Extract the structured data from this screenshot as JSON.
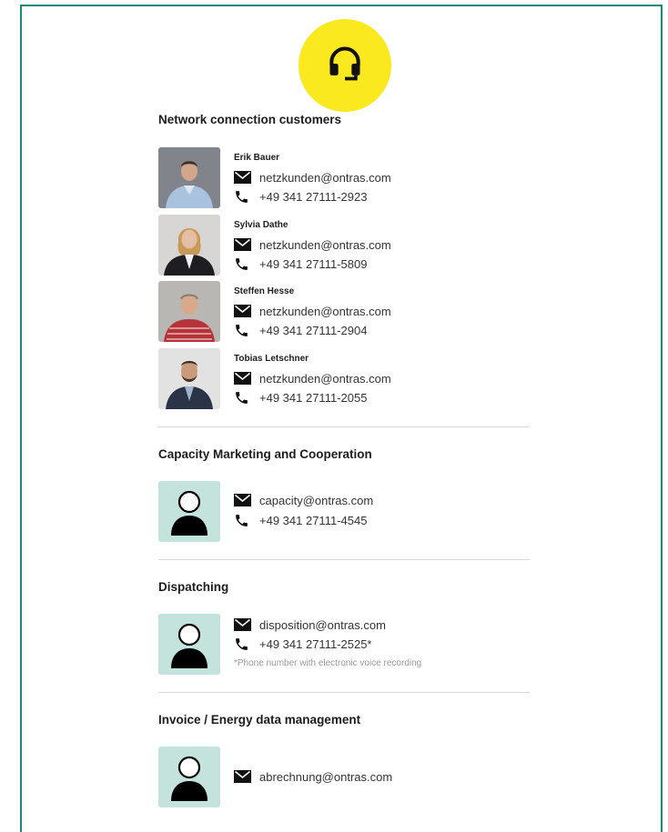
{
  "header": {
    "icon": "headset-icon",
    "badge_color": "#fbe920"
  },
  "accent_border": "#1a8a78",
  "sections": [
    {
      "title": "Network connection customers",
      "contacts": [
        {
          "name": "Erik Bauer",
          "email": "netzkunden@ontras.com",
          "phone": "+49 341 27111-2923"
        },
        {
          "name": "Sylvia Dathe",
          "email": "netzkunden@ontras.com",
          "phone": "+49 341 27111-5809"
        },
        {
          "name": "Steffen Hesse",
          "email": "netzkunden@ontras.com",
          "phone": "+49 341 27111-2904"
        },
        {
          "name": "Tobias Letschner",
          "email": "netzkunden@ontras.com",
          "phone": "+49 341 27111-2055"
        }
      ]
    },
    {
      "title": "Capacity Marketing and Cooperation",
      "contacts": [
        {
          "email": "capacity@ontras.com",
          "phone": "+49 341 27111-4545"
        }
      ]
    },
    {
      "title": "Dispatching",
      "contacts": [
        {
          "email": "disposition@ontras.com",
          "phone": "+49 341 27111-2525*",
          "note": "*Phone number with electronic voice recording"
        }
      ]
    },
    {
      "title": "Invoice / Energy data management",
      "contacts": [
        {
          "email": "abrechnung@ontras.com"
        }
      ]
    }
  ]
}
